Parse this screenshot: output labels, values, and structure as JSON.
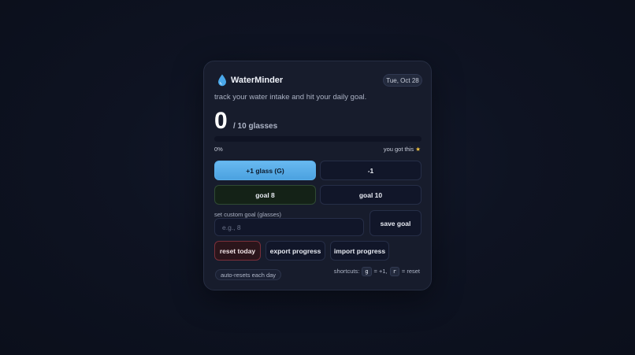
{
  "app": {
    "icon": "water-drop-icon",
    "title": "WaterMinder",
    "date": "Tue, Oct 28",
    "subtitle": "track your water intake and hit your daily goal."
  },
  "progress": {
    "count": "0",
    "goal_text": "/ 10 glasses",
    "fraction": 0,
    "percent_label": "0%",
    "cheer_text": "you got this",
    "cheer_icon": "star-icon"
  },
  "buttons": {
    "add": "+1 glass (G)",
    "remove": "-1",
    "goal8": "goal 8",
    "goal10": "goal 10",
    "save_goal": "save goal",
    "reset": "reset today",
    "export": "export progress",
    "import": "import progress"
  },
  "custom_goal": {
    "label": "set custom goal (glasses)",
    "placeholder": "e.g., 8",
    "value": ""
  },
  "footer": {
    "badge": "auto-resets each day",
    "shortcuts_prefix": "shortcuts:",
    "key_g": "g",
    "key_g_desc": "= +1,",
    "key_r": "r",
    "key_r_desc": "= reset"
  },
  "colors": {
    "accent": "#5aaee8",
    "background": "#0e1322",
    "card": "#171c2c",
    "goal_button": "#142217",
    "reset_button": "#2b151b"
  }
}
